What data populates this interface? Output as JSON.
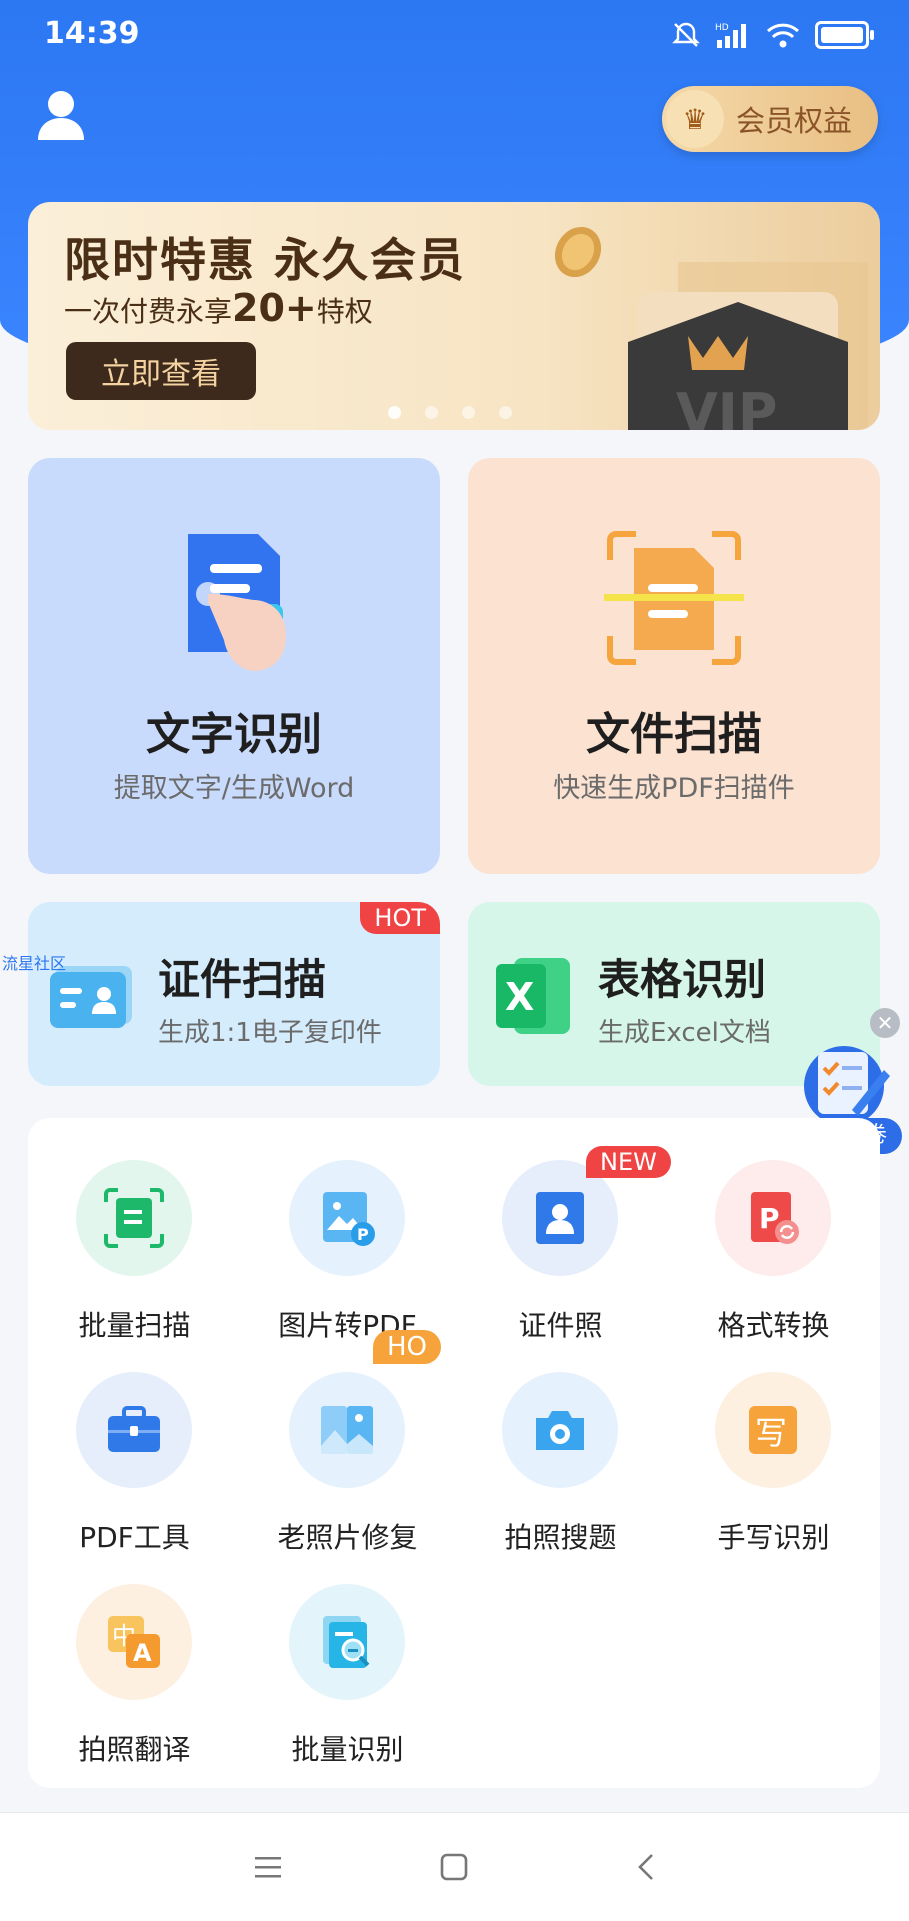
{
  "status": {
    "time": "14:39",
    "hd": "HD"
  },
  "header": {
    "member_label": "会员权益"
  },
  "banner": {
    "title": "限时特惠  永久会员",
    "sub_prefix": "一次付费永享",
    "sub_highlight": "20+",
    "sub_suffix": "特权",
    "button": "立即查看",
    "card_text": "VIP"
  },
  "cards": {
    "text_recognition": {
      "title": "文字识别",
      "subtitle": "提取文字/生成Word"
    },
    "file_scan": {
      "title": "文件扫描",
      "subtitle": "快速生成PDF扫描件"
    },
    "id_scan": {
      "title": "证件扫描",
      "subtitle": "生成1:1电子复印件",
      "tag": "HOT",
      "side_text": "流星社区"
    },
    "table_recognition": {
      "title": "表格识别",
      "subtitle": "生成Excel文档"
    }
  },
  "survey": {
    "label": "调查问卷"
  },
  "tools": [
    {
      "label": "批量扫描"
    },
    {
      "label": "图片转PDF"
    },
    {
      "label": "证件照",
      "tag": "NEW"
    },
    {
      "label": "格式转换"
    },
    {
      "label": "PDF工具"
    },
    {
      "label": "老照片修复",
      "tag": "HO"
    },
    {
      "label": "拍照搜题"
    },
    {
      "label": "手写识别"
    },
    {
      "label": "拍照翻译"
    },
    {
      "label": "批量识别"
    }
  ],
  "colors": {
    "primary": "#2c77f2",
    "hot": "#f04444",
    "gold": "#e8bf83"
  }
}
